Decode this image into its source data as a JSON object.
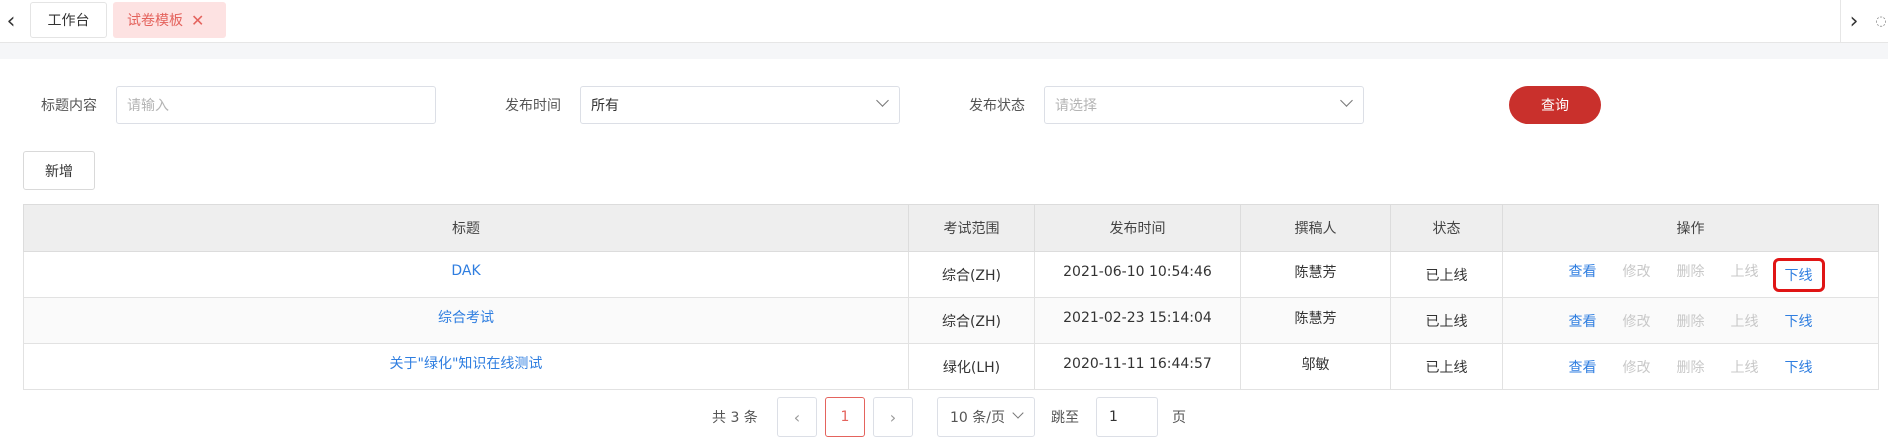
{
  "tabs": {
    "home_label": "工作台",
    "active_label": "试卷模板",
    "close_glyph": "✕",
    "prev_glyph": "‹",
    "next_glyph": "›"
  },
  "filters": {
    "title_label": "标题内容",
    "title_placeholder": "请输入",
    "time_label": "发布时间",
    "time_value": "所有",
    "status_label": "发布状态",
    "status_placeholder": "请选择",
    "query_button": "查询"
  },
  "toolbar": {
    "add_button": "新增"
  },
  "table": {
    "columns": [
      "标题",
      "考试范围",
      "发布时间",
      "撰稿人",
      "状态",
      "操作"
    ],
    "rows": [
      {
        "title": "DAK",
        "scope": "综合(ZH)",
        "time": "2021-06-10 10:54:46",
        "author": "陈慧芳",
        "status": "已上线"
      },
      {
        "title": "综合考试",
        "scope": "综合(ZH)",
        "time": "2021-02-23 15:14:04",
        "author": "陈慧芳",
        "status": "已上线"
      },
      {
        "title": "关于\"绿化\"知识在线测试",
        "scope": "绿化(LH)",
        "time": "2020-11-11 16:44:57",
        "author": "邬敏",
        "status": "已上线"
      }
    ],
    "actions": {
      "view": "查看",
      "edit": "修改",
      "delete": "删除",
      "online": "上线",
      "offline": "下线"
    }
  },
  "pagination": {
    "total_text": "共 3 条",
    "current_page": "1",
    "page_size": "10 条/页",
    "jump_label": "跳至",
    "jump_value": "1",
    "page_unit": "页",
    "prev_glyph": "‹",
    "next_glyph": "›"
  },
  "colors": {
    "accent": "#c9302c",
    "link": "#2f7ee0",
    "active_tab_bg": "#fde2e2",
    "highlight_box": "#e01515"
  }
}
